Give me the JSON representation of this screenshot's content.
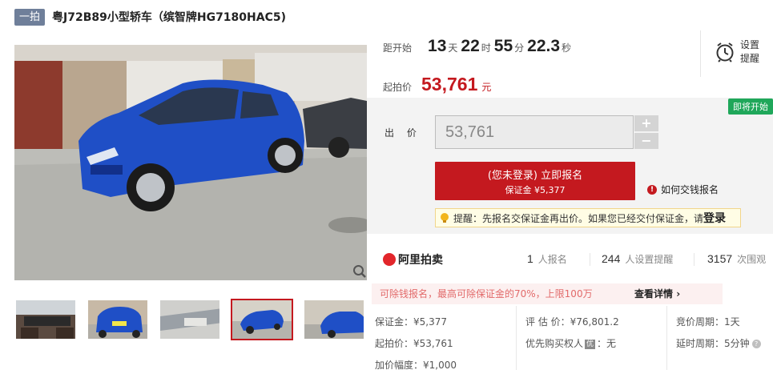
{
  "header": {
    "tag": "一拍",
    "title": "粤J72B89小型轿车（缤智牌HG7180HAC5)"
  },
  "thumbnails": [
    {
      "name": "interior",
      "active": false
    },
    {
      "name": "rear",
      "active": false
    },
    {
      "name": "detail",
      "active": false
    },
    {
      "name": "front-side",
      "active": true
    },
    {
      "name": "side",
      "active": false
    }
  ],
  "countdown": {
    "label": "距开始",
    "days": "13",
    "days_unit": "天",
    "hours": "22",
    "hours_unit": "时",
    "minutes": "55",
    "minutes_unit": "分",
    "seconds": "22.3",
    "seconds_unit": "秒"
  },
  "reminder": {
    "line1": "设置",
    "line2": "提醒",
    "icon": "alarm-clock-icon"
  },
  "start_price": {
    "label": "起拍价",
    "value": "53,761",
    "unit": "元",
    "color": "#c4191f"
  },
  "bid": {
    "status_badge": "即将开始",
    "label": "出 价",
    "input_value": "53,761",
    "plus": "+",
    "minus": "−",
    "signup_line1": "(您未登录) 立即报名",
    "signup_line2": "保证金 ¥5,377",
    "how_to_pay": "如何交钱报名",
    "tip_text": "提醒：先报名交保证金再出价。如果您已经交付保证金，请",
    "tip_link": "登录"
  },
  "stats": {
    "logo_text": "阿里拍卖",
    "signups": "1",
    "signups_label": "人报名",
    "reminders": "244",
    "reminders_label": "人设置提醒",
    "views": "3157",
    "views_label": "次围观"
  },
  "promo": {
    "text": "可除钱报名，最高可除保证金的70%，上限100万",
    "link": "查看详情"
  },
  "details": {
    "deposit": "保证金：¥5,377",
    "start": "起拍价：¥53,761",
    "increment": "加价幅度：¥1,000",
    "appraisal": "评 估 价：¥76,801.2",
    "priority_prefix": "优先购买权人",
    "priority_badge": "优",
    "priority_value": "：无",
    "cycle": "竞价周期：1天",
    "extend": "延时周期：5分钟"
  },
  "colors": {
    "accent": "#c4191f",
    "badge_green": "#1fa75a",
    "tag": "#6f7f9a"
  }
}
